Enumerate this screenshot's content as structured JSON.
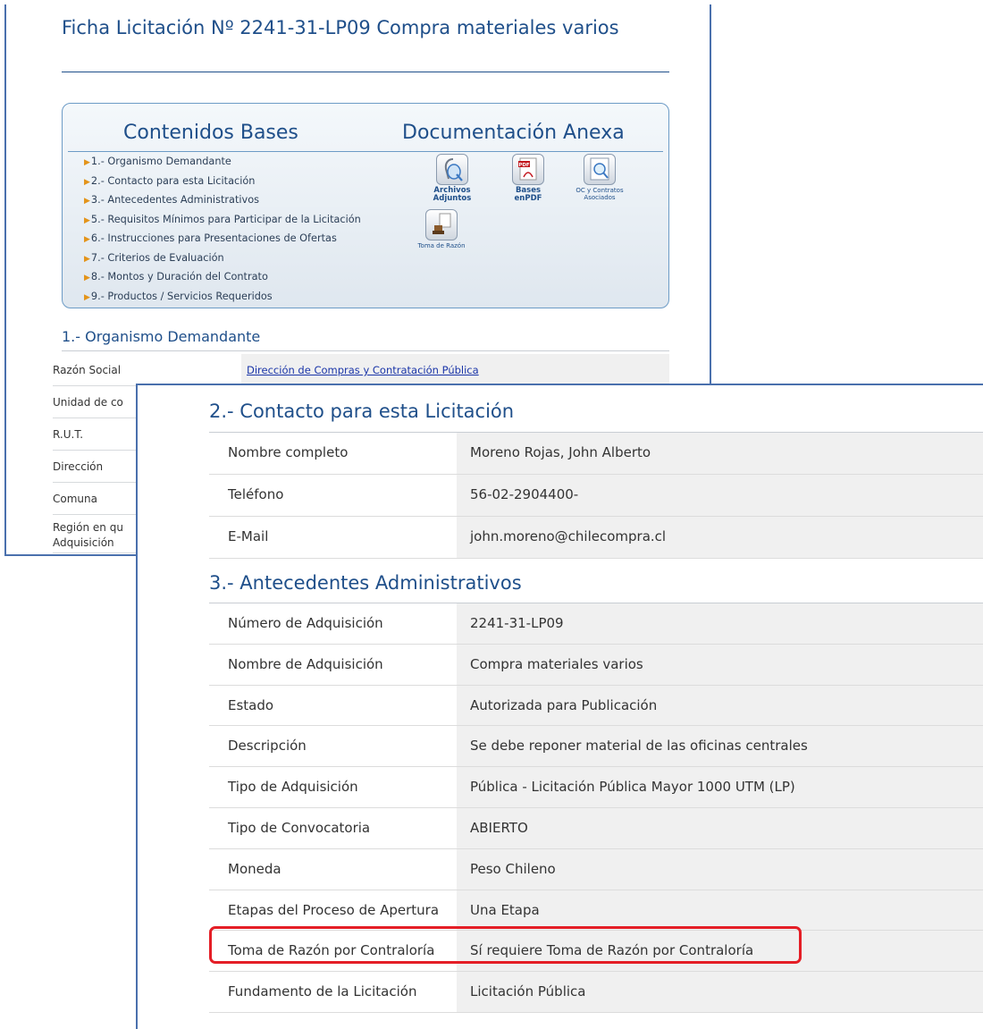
{
  "page": {
    "title": "Ficha Licitación Nº 2241-31-LP09 Compra materiales varios"
  },
  "menu": {
    "heading_left": "Contenidos Bases",
    "heading_right": "Documentación Anexa",
    "items": [
      "1.- Organismo Demandante",
      "2.- Contacto para esta Licitación",
      "3.- Antecedentes Administrativos",
      "5.- Requisitos Mínimos para Participar de la Licitación",
      "6.- Instrucciones para Presentaciones de Ofertas",
      "7.- Criterios de Evaluación",
      "8.- Montos y Duración del Contrato",
      "9.- Productos / Servicios Requeridos"
    ],
    "docs": {
      "archivos": "Archivos Adjuntos",
      "bases": "Bases enPDF",
      "pdf_badge": "PDF",
      "oc": "OC y Contratos Asociados",
      "toma": "Toma de Razón"
    }
  },
  "section1": {
    "title": "1.- Organismo Demandante",
    "rows": [
      {
        "label": "Razón Social",
        "value": "Dirección de Compras y Contratación Pública"
      },
      {
        "label": "Unidad de co",
        "value": ""
      },
      {
        "label": "R.U.T.",
        "value": ""
      },
      {
        "label": "Dirección",
        "value": ""
      },
      {
        "label": "Comuna",
        "value": ""
      },
      {
        "label": "Región en qu",
        "label2": "Adquisición",
        "value": ""
      }
    ]
  },
  "section2": {
    "title": "2.- Contacto para esta Licitación",
    "rows": [
      {
        "label": "Nombre completo",
        "value": "Moreno Rojas, John Alberto"
      },
      {
        "label": "Teléfono",
        "value": "56-02-2904400-"
      },
      {
        "label": "E-Mail",
        "value": "john.moreno@chilecompra.cl"
      }
    ]
  },
  "section3": {
    "title": "3.- Antecedentes Administrativos",
    "rows": [
      {
        "label": "Número de Adquisición",
        "value": "2241-31-LP09"
      },
      {
        "label": "Nombre de Adquisición",
        "value": "Compra materiales varios"
      },
      {
        "label": "Estado",
        "value": "Autorizada para Publicación"
      },
      {
        "label": "Descripción",
        "value": "Se debe reponer material de las oficinas centrales"
      },
      {
        "label": "Tipo de Adquisición",
        "value": "Pública - Licitación Pública Mayor 1000 UTM (LP)"
      },
      {
        "label": "Tipo de Convocatoria",
        "value": "ABIERTO"
      },
      {
        "label": "Moneda",
        "value": "Peso Chileno"
      },
      {
        "label": "Etapas del Proceso de Apertura",
        "value": "Una Etapa"
      },
      {
        "label": "Toma de Razón por Contraloría",
        "value": "Sí requiere Toma de Razón por Contraloría"
      },
      {
        "label": "Fundamento de la Licitación",
        "value": "Licitación Pública"
      }
    ]
  },
  "colors": {
    "title": "#1f4f8a",
    "window_border": "#4a70ad",
    "highlight": "#e41e26",
    "menu_arrow": "#e3941a",
    "link": "#1a35a8"
  }
}
